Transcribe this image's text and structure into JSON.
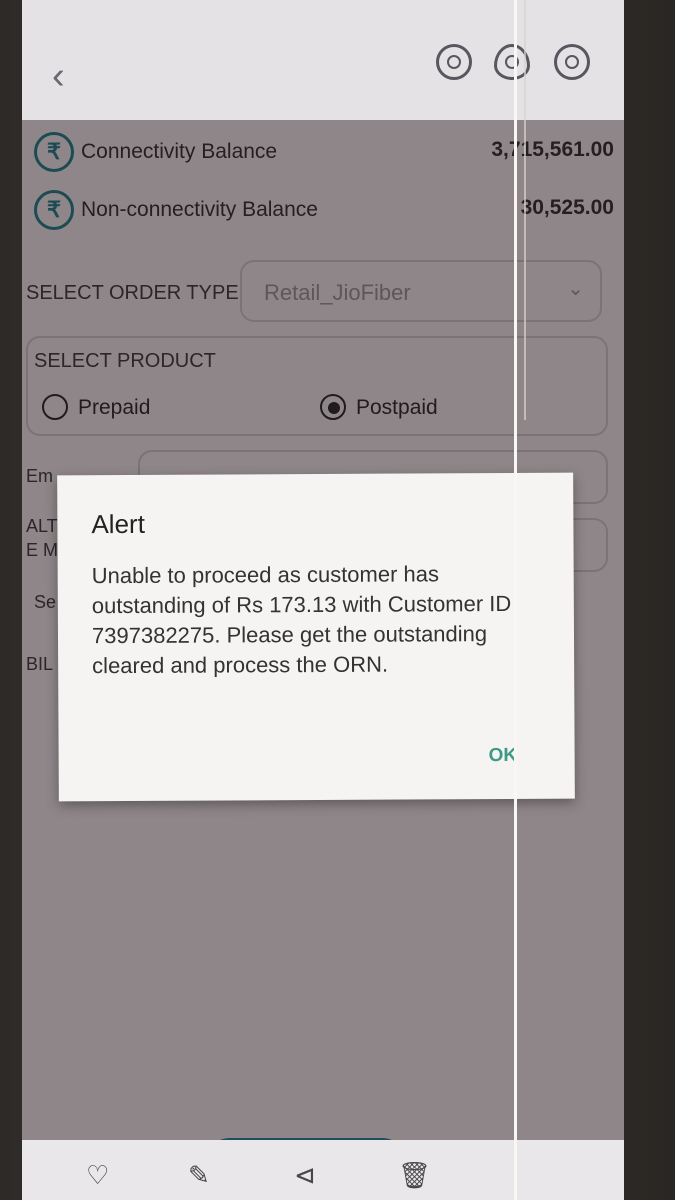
{
  "balances": [
    {
      "label": "Connectivity Balance",
      "value": "3,715,561.00"
    },
    {
      "label": "Non-connectivity Balance",
      "value": "30,525.00"
    }
  ],
  "order_type": {
    "label": "SELECT ORDER TYPE",
    "value": "Retail_JioFiber"
  },
  "product": {
    "label": "SELECT PRODUCT",
    "options": [
      {
        "label": "Prepaid",
        "selected": false
      },
      {
        "label": "Postpaid",
        "selected": true
      }
    ]
  },
  "partial_labels": {
    "email": "Em",
    "alt_line1": "ALT",
    "alt_line2": "E M",
    "se": "Se",
    "bil": "BIL"
  },
  "alert": {
    "title": "Alert",
    "message": "Unable to proceed as customer has outstanding of Rs 173.13 with Customer ID 7397382275. Please get the outstanding cleared and process the ORN.",
    "ok_label": "OK"
  },
  "icons": {
    "back": "back-arrow-icon",
    "header": [
      "replay-icon",
      "eye-icon",
      "sync-icon"
    ],
    "bottom": [
      "heart-icon",
      "edit-icon",
      "share-icon",
      "delete-icon"
    ]
  },
  "colors": {
    "brand_teal": "#1c4f5a",
    "ok_green": "#3e9a86"
  }
}
